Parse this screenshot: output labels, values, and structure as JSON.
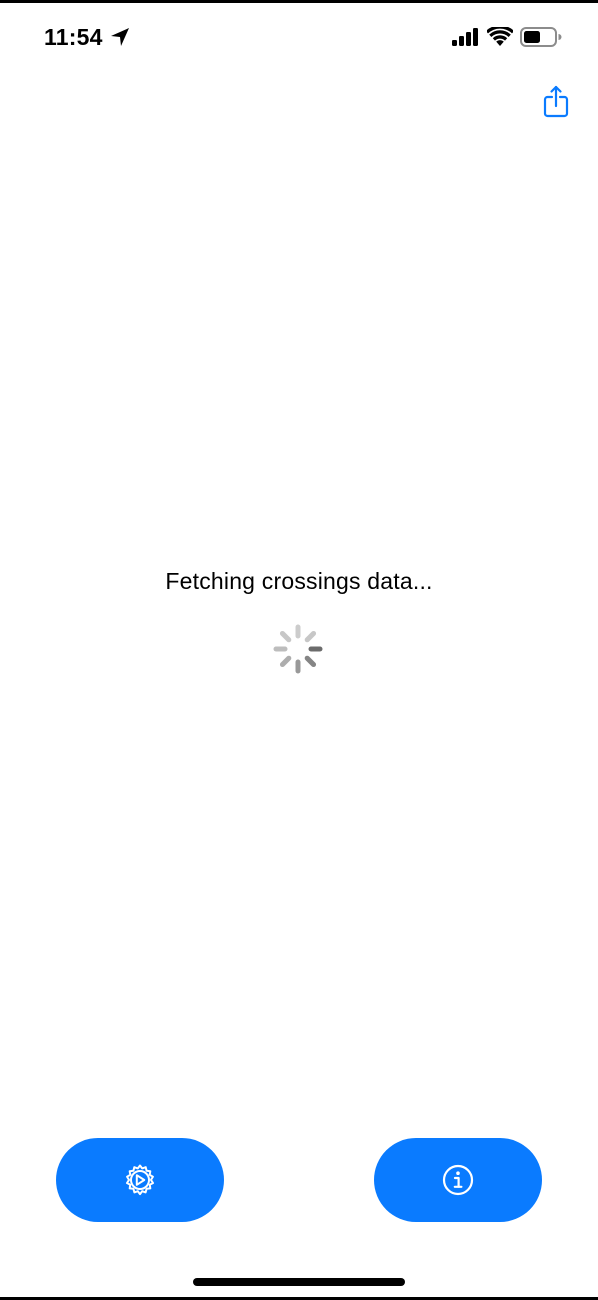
{
  "status_bar": {
    "time": "11:54",
    "icons": [
      "location-arrow-icon",
      "cellular-signal-icon",
      "wifi-icon",
      "battery-icon"
    ],
    "battery_level": 0.55
  },
  "toolbar": {
    "share_icon": "share-icon"
  },
  "loading": {
    "message": "Fetching crossings data...",
    "spinner_icon": "activity-indicator-icon"
  },
  "bottom_bar": {
    "left_button_icon": "settings-gear-icon",
    "right_button_icon": "info-icon"
  },
  "colors": {
    "accent": "#0a7bff",
    "background": "#ffffff",
    "text": "#000000",
    "spinner": "#9a9a9a"
  }
}
